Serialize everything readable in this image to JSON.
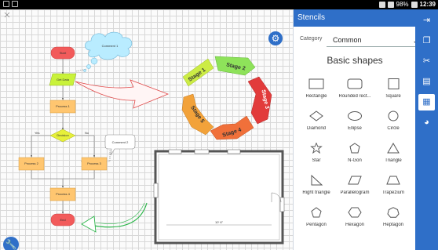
{
  "status": {
    "battery": "98%",
    "time": "12:39"
  },
  "canvas": {
    "flow": {
      "start": "Start",
      "getdata": "Get Data",
      "process1": "Process 1",
      "decision": "Decision",
      "process2": "Process 2",
      "process3": "Process 3",
      "process4": "Process 4",
      "end": "End",
      "yes": "Yes",
      "no": "No"
    },
    "comment1": "Comment 1",
    "comment2": "Comment 2",
    "stages": [
      "Stage 1",
      "Stage 2",
      "Stage 3",
      "Stage 4",
      "Stage 5"
    ],
    "plan_dimension": "10' 6\""
  },
  "panel": {
    "title": "Stencils",
    "category_label": "Category",
    "category_value": "Common",
    "section": "Basic shapes",
    "shapes": [
      {
        "label": "Rectangle",
        "icon": "rectangle-shape-icon"
      },
      {
        "label": "Rounded rect...",
        "icon": "rounded-rectangle-shape-icon"
      },
      {
        "label": "Square",
        "icon": "square-shape-icon"
      },
      {
        "label": "Diamond",
        "icon": "diamond-shape-icon"
      },
      {
        "label": "Ellipse",
        "icon": "ellipse-shape-icon"
      },
      {
        "label": "Circle",
        "icon": "circle-shape-icon"
      },
      {
        "label": "Star",
        "icon": "star-shape-icon"
      },
      {
        "label": "N-Gon",
        "icon": "ngon-shape-icon"
      },
      {
        "label": "Triangle",
        "icon": "triangle-shape-icon"
      },
      {
        "label": "Right triangle",
        "icon": "right-triangle-shape-icon"
      },
      {
        "label": "Parallelogram",
        "icon": "parallelogram-shape-icon"
      },
      {
        "label": "Trapezium",
        "icon": "trapezium-shape-icon"
      },
      {
        "label": "Pentagon",
        "icon": "pentagon-shape-icon"
      },
      {
        "label": "Hexagon",
        "icon": "hexagon-shape-icon"
      },
      {
        "label": "Heptagon",
        "icon": "heptagon-shape-icon"
      }
    ]
  },
  "toolbar": {
    "tools": [
      "exit-icon",
      "copy-icon",
      "tools-icon",
      "document-icon",
      "stencils-icon",
      "palette-icon"
    ],
    "accent": "#2f6fc8"
  }
}
